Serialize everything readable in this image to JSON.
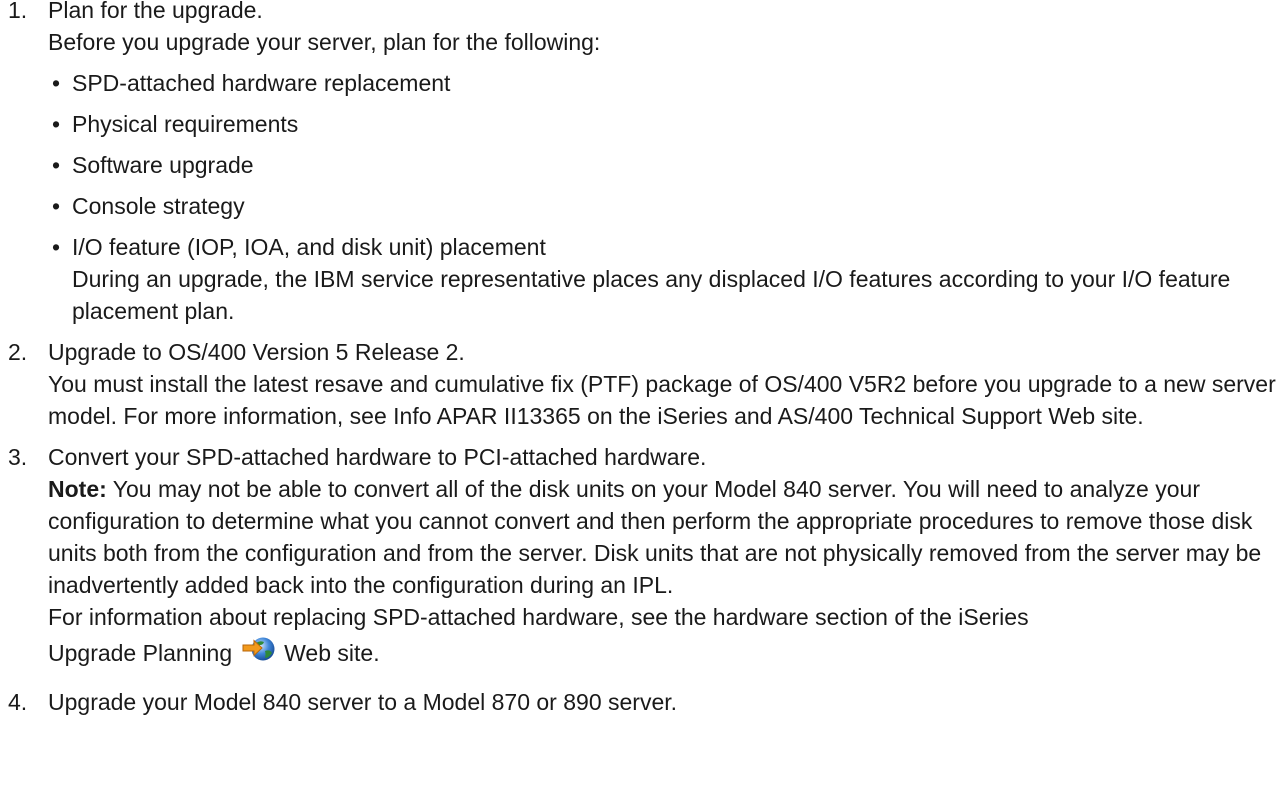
{
  "steps": [
    {
      "number": "1.",
      "title": "Plan for the upgrade.",
      "intro": "Before you upgrade your server, plan for the following:",
      "bullets": [
        "SPD-attached hardware replacement",
        "Physical requirements",
        "Software upgrade",
        "Console strategy",
        "I/O feature (IOP, IOA, and disk unit) placement"
      ],
      "bullet_detail": "During an upgrade, the IBM service representative places any displaced I/O features according to your I/O feature placement plan."
    },
    {
      "number": "2.",
      "title": "Upgrade to OS/400 Version 5 Release 2.",
      "body": "You must install the latest resave and cumulative fix (PTF) package of OS/400 V5R2 before you upgrade to a new server model. For more information, see Info APAR II13365 on the iSeries and AS/400 Technical Support Web site."
    },
    {
      "number": "3.",
      "title": "Convert your SPD-attached hardware to PCI-attached hardware.",
      "note_label": "Note:",
      "note_text": "You may not be able to convert all of the disk units on your Model 840 server. You will need to analyze your configuration to determine what you cannot convert and then perform the appropriate procedures to remove those disk units both from the configuration and from the server. Disk units that are not physically removed from the server may be inadvertently added back into the configuration during an IPL.",
      "info_text": "For information about replacing SPD-attached hardware, see the hardware section of the iSeries",
      "link_text": "Upgrade Planning",
      "link_suffix": "Web site.",
      "link_icon": "external-link-globe-icon"
    },
    {
      "number": "4.",
      "title": "Upgrade your Model 840 server to a Model 870 or 890 server."
    }
  ]
}
